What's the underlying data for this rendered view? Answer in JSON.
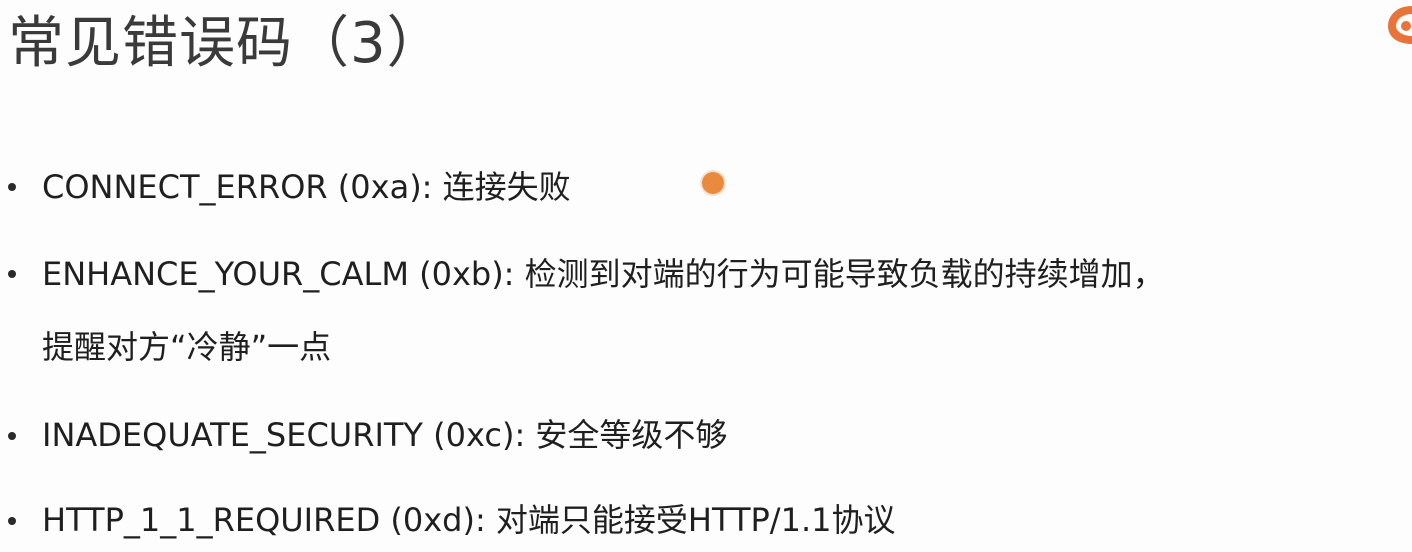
{
  "title": "常见错误码（3）",
  "colors": {
    "pointer": "#ea8a3f",
    "logo": "#e8743a"
  },
  "bullets": [
    {
      "line1": "CONNECT_ERROR (0xa): 连接失败",
      "line2": ""
    },
    {
      "line1": "ENHANCE_YOUR_CALM (0xb): 检测到对端的行为可能导致负载的持续增加，",
      "line2": "提醒对方“冷静”一点"
    },
    {
      "line1": "INADEQUATE_SECURITY (0xc): 安全等级不够",
      "line2": ""
    },
    {
      "line1": "HTTP_1_1_REQUIRED (0xd): 对端只能接受HTTP/1.1协议",
      "line2": ""
    }
  ]
}
